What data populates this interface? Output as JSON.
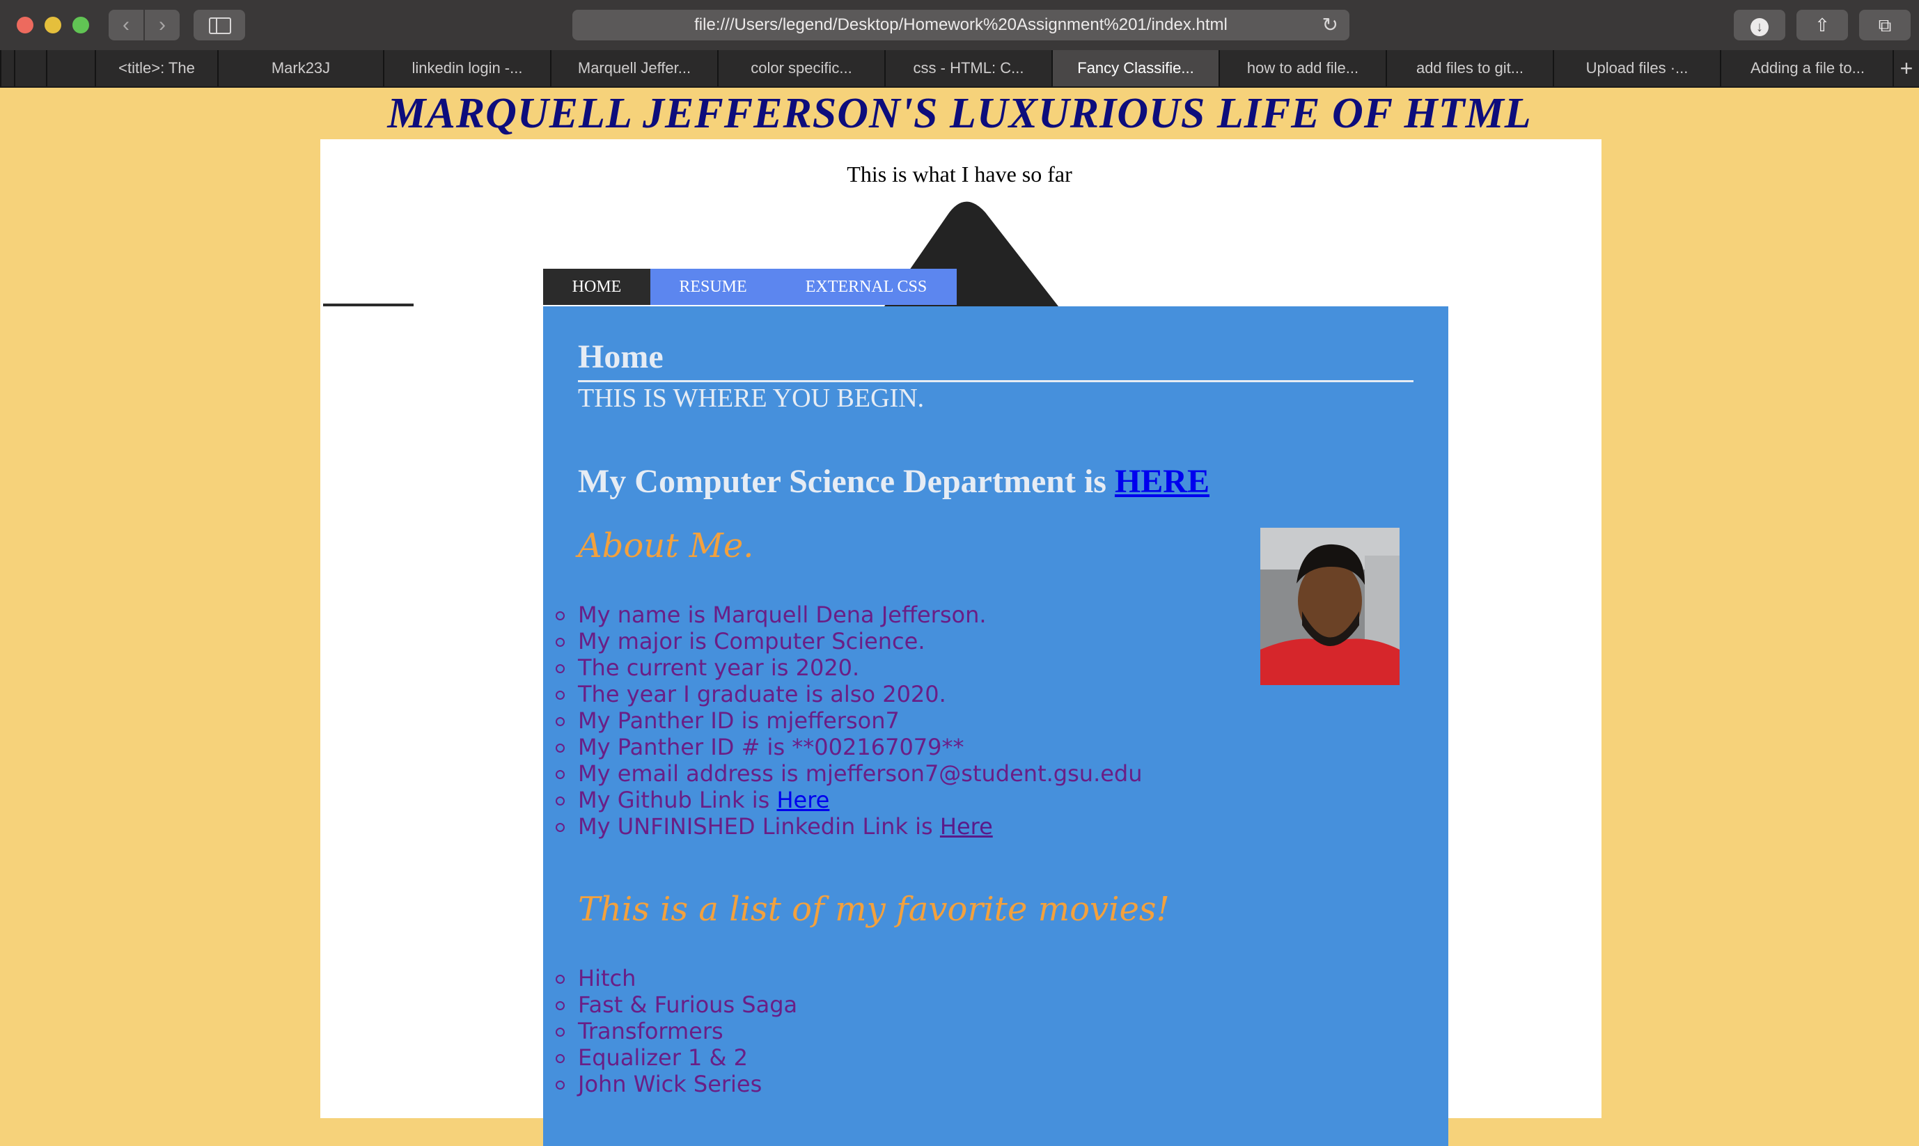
{
  "browser": {
    "url": "file:///Users/legend/Desktop/Homework%20Assignment%201/index.html",
    "tabs": [
      {
        "label": "<title>: The"
      },
      {
        "label": "Mark23J"
      },
      {
        "label": "linkedin login -..."
      },
      {
        "label": "Marquell Jeffer..."
      },
      {
        "label": "color specific..."
      },
      {
        "label": "css - HTML: C..."
      },
      {
        "label": "Fancy Classifie...",
        "active": true
      },
      {
        "label": "how to add file..."
      },
      {
        "label": "add files to git..."
      },
      {
        "label": "Upload files ·..."
      },
      {
        "label": "Adding a file to..."
      }
    ]
  },
  "page": {
    "title": "MARQUELL JEFFERSON'S LUXURIOUS LIFE OF HTML",
    "intro": "This is what I have so far",
    "nav": {
      "home": "HOME",
      "resume": "RESUME",
      "external_css": "EXTERNAL CSS"
    },
    "home_heading": "Home",
    "begin_text": "THIS IS WHERE YOU BEGIN.",
    "dept_prefix": "My Computer Science Department is ",
    "dept_link": "HERE",
    "about_heading": "About Me.",
    "about_items": [
      "My name is Marquell Dena Jefferson.",
      "My major is Computer Science.",
      "The current year is 2020.",
      "The year I graduate is also 2020.",
      "My Panther ID is mjefferson7",
      "My Panther ID # is **002167079**",
      "My email address is mjefferson7@student.gsu.edu"
    ],
    "github_prefix": "My Github Link is ",
    "github_link": "Here",
    "linkedin_prefix": "My UNFINISHED Linkedin Link is ",
    "linkedin_link": "Here",
    "movies_heading": "This is a list of my favorite movies!",
    "movies": [
      "Hitch",
      "Fast & Furious Saga",
      "Transformers",
      "Equalizer 1 & 2",
      "John Wick Series"
    ]
  },
  "colors": {
    "page_background": "#f6d27a",
    "title": "#0d0d7c",
    "panel": "#4690dc",
    "nav_active": "#2b2b2b",
    "nav_inactive": "#5c86ef",
    "heading_orange": "#f3a13d",
    "list_text": "#6a1e86"
  }
}
